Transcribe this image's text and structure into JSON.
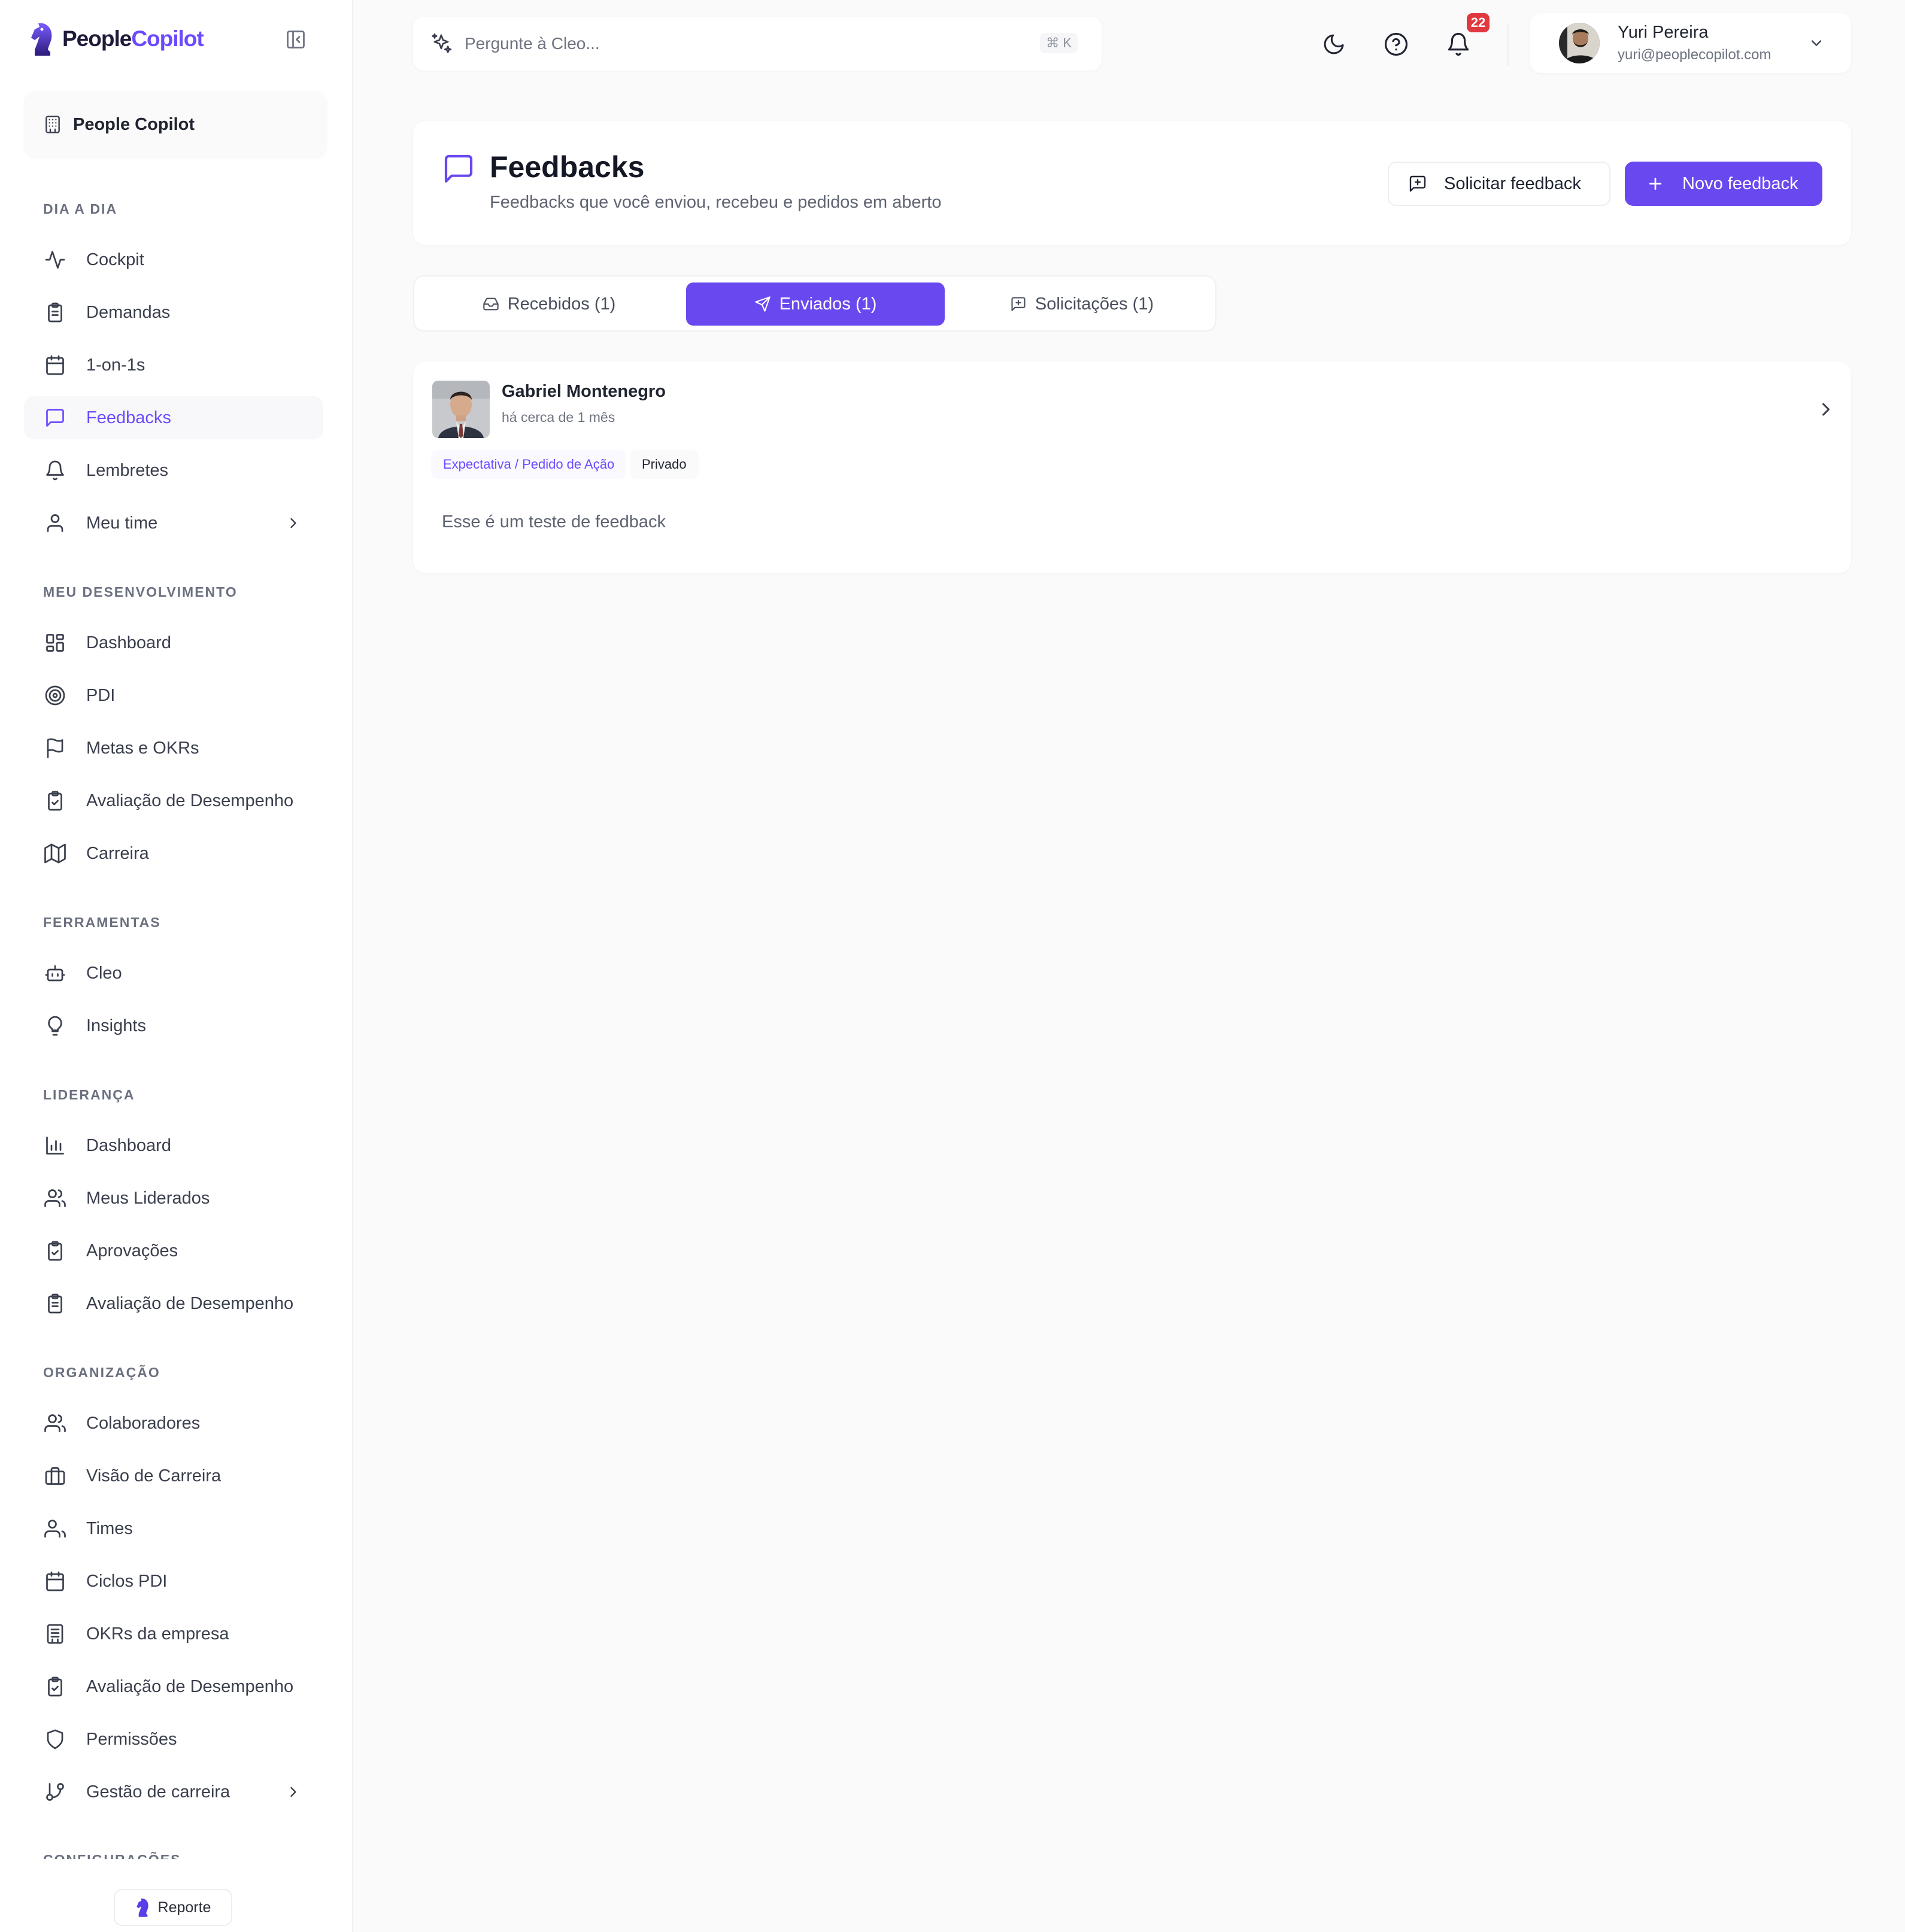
{
  "brand": {
    "part1": "People",
    "part2": "Copilot"
  },
  "org": {
    "name": "People Copilot"
  },
  "sidebar": {
    "sections": [
      {
        "title": "DIA A DIA"
      },
      {
        "title": "MEU DESENVOLVIMENTO"
      },
      {
        "title": "FERRAMENTAS"
      },
      {
        "title": "LIDERANÇA"
      },
      {
        "title": "ORGANIZAÇÃO"
      },
      {
        "title": "CONFIGURAÇÕES"
      }
    ],
    "items": {
      "cockpit": "Cockpit",
      "demandas": "Demandas",
      "oneonones": "1-on-1s",
      "feedbacks": "Feedbacks",
      "lembretes": "Lembretes",
      "meutime": "Meu time",
      "dashboard": "Dashboard",
      "pdi": "PDI",
      "metas": "Metas e OKRs",
      "avaliacao": "Avaliação de Desempenho",
      "carreira": "Carreira",
      "cleo": "Cleo",
      "insights": "Insights",
      "lid_dashboard": "Dashboard",
      "liderados": "Meus Liderados",
      "aprovacoes": "Aprovações",
      "lid_avaliacao": "Avaliação de Desempenho",
      "colaboradores": "Colaboradores",
      "visao_carreira": "Visão de Carreira",
      "times": "Times",
      "ciclos_pdi": "Ciclos PDI",
      "okrs_empresa": "OKRs da empresa",
      "org_avaliacao": "Avaliação de Desempenho",
      "permissoes": "Permissões",
      "gestao_carreira": "Gestão de carreira"
    },
    "report_label": "Reporte"
  },
  "search": {
    "placeholder": "Pergunte à Cleo...",
    "shortcut": "⌘ K"
  },
  "notifications": {
    "count": "22"
  },
  "user": {
    "name": "Yuri Pereira",
    "email": "yuri@peoplecopilot.com"
  },
  "page": {
    "title": "Feedbacks",
    "subtitle": "Feedbacks que você enviou, recebeu e pedidos em aberto",
    "request_button": "Solicitar feedback",
    "new_button": "Novo feedback"
  },
  "tabs": [
    {
      "label": "Recebidos (1)"
    },
    {
      "label": "Enviados (1)"
    },
    {
      "label": "Solicitações (1)"
    }
  ],
  "feedback_items": [
    {
      "name": "Gabriel Montenegro",
      "time": "há cerca de 1 mês",
      "type_tag": "Expectativa / Pedido de Ação",
      "visibility_tag": "Privado",
      "text": "Esse é um teste de feedback"
    }
  ],
  "colors": {
    "accent": "#6a48ef",
    "badge": "#e0383e"
  }
}
